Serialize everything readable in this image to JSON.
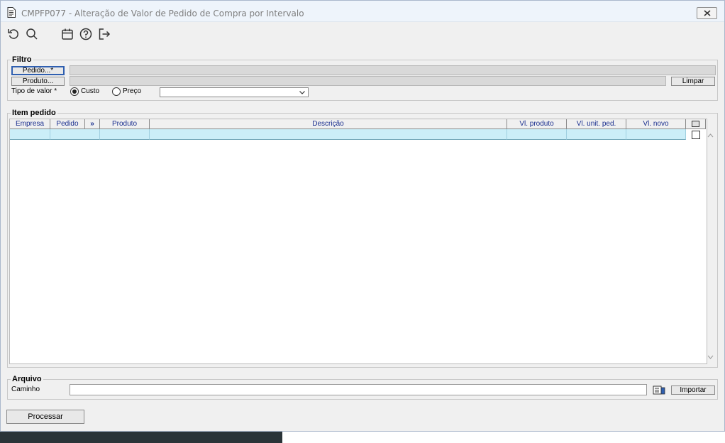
{
  "window": {
    "title": "CMPFP077 - Alteração de Valor de Pedido de Compra por Intervalo"
  },
  "toolbar": {
    "icons": [
      "undo-icon",
      "search-icon",
      "calendar-icon",
      "help-icon",
      "exit-icon"
    ]
  },
  "filtro": {
    "group_title": "Filtro",
    "pedido_button": "Pedido...*",
    "produto_button": "Produto...",
    "limpar_button": "Limpar",
    "tipo_valor_label": "Tipo de valor *",
    "options": [
      {
        "label": "Custo",
        "checked": true
      },
      {
        "label": "Preço",
        "checked": false
      }
    ],
    "select_value": ""
  },
  "item_pedido": {
    "group_title": "Item pedido",
    "columns": [
      "Empresa",
      "Pedido",
      "»",
      "Produto",
      "Descrição",
      "Vl. produto",
      "Vl. unit. ped.",
      "Vl. novo"
    ]
  },
  "arquivo": {
    "group_title": "Arquivo",
    "caminho_label": "Caminho",
    "caminho_value": "",
    "importar_button": "Importar"
  },
  "footer": {
    "processar_button": "Processar"
  },
  "colors": {
    "row_highlight": "#cbeef8",
    "header_text": "#1a2f8f",
    "window_bg": "#f0f0f0"
  }
}
